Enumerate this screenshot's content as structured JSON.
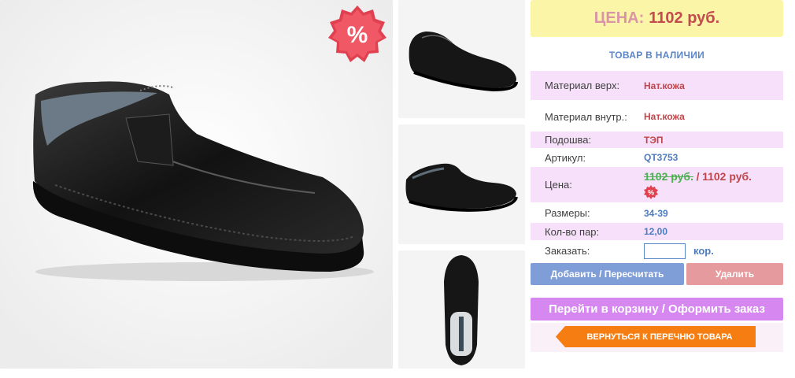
{
  "product": {
    "main_image": "black-leather-slip-on-shoe",
    "sale_badge": "%",
    "thumbnails": [
      "shoe-side-view",
      "shoe-angle-view",
      "shoe-top-view"
    ]
  },
  "price_box": {
    "label": "ЦЕНА:",
    "value": "1102 руб."
  },
  "stock_status": "ТОВАР В НАЛИЧИИ",
  "specs": {
    "material_top": {
      "label": "Материал верх:",
      "value": "Нат.кожа"
    },
    "material_inner": {
      "label": "Материал внутр.:",
      "value": "Нат.кожа"
    },
    "sole": {
      "label": "Подошва:",
      "value": "ТЭП"
    },
    "article": {
      "label": "Артикул:",
      "value": "QT3753"
    },
    "price": {
      "label": "Цена:",
      "old": "1102 руб.",
      "separator": "/",
      "new": "1102 руб.",
      "badge": "%"
    },
    "sizes": {
      "label": "Размеры:",
      "value": "34-39"
    },
    "pairs": {
      "label": "Кол-во пар:",
      "value": "12,00"
    },
    "order": {
      "label": "Заказать:",
      "input_value": "",
      "unit": "кор."
    }
  },
  "buttons": {
    "add": "Добавить / Пересчитать",
    "delete": "Удалить",
    "cart": "Перейти в корзину / Оформить заказ",
    "back": "ВЕРНУТЬСЯ К ПЕРЕЧНЮ ТОВАРА"
  },
  "colors": {
    "price_bg": "#fbf5a8",
    "row_alt": "#f6e0fa",
    "add_btn": "#7f9dd6",
    "delete_btn": "#e59a9d",
    "cart_btn": "#d688f0",
    "back_btn": "#f57d12",
    "accent_blue": "#4d7cc0",
    "accent_red": "#c0454a"
  }
}
